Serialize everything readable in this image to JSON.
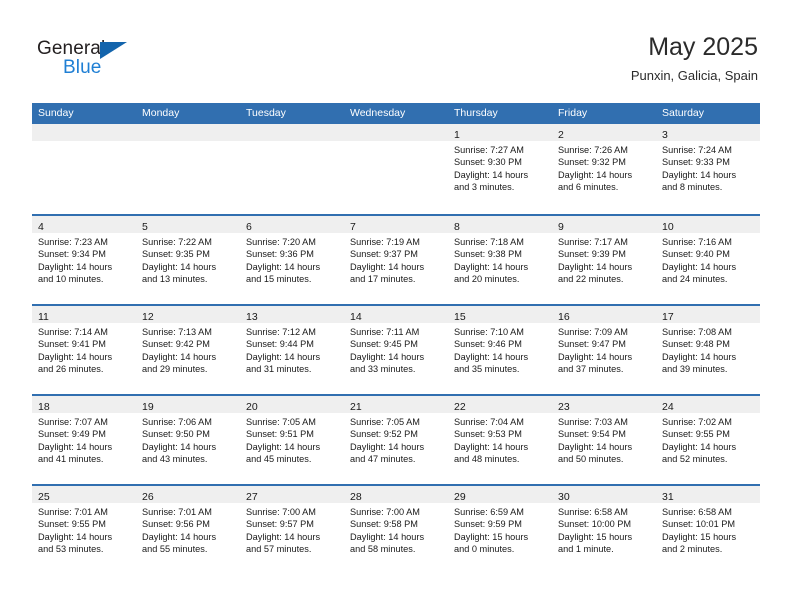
{
  "logo": {
    "word_top": "General",
    "word_bottom": "Blue",
    "triangle_color": "#1364ac",
    "blue_text_color": "#1f7fd4"
  },
  "header": {
    "title": "May 2025",
    "subtitle": "Punxin, Galicia, Spain"
  },
  "theme": {
    "header_blue": "#316fb0",
    "day_band_gray": "#efefef",
    "text_color": "#1a1a1a"
  },
  "weekday_headers": [
    "Sunday",
    "Monday",
    "Tuesday",
    "Wednesday",
    "Thursday",
    "Friday",
    "Saturday"
  ],
  "weeks": [
    [
      {
        "day": "",
        "sunrise": "",
        "sunset": "",
        "daylight_line1": "",
        "daylight_line2": "",
        "empty": true
      },
      {
        "day": "",
        "sunrise": "",
        "sunset": "",
        "daylight_line1": "",
        "daylight_line2": "",
        "empty": true
      },
      {
        "day": "",
        "sunrise": "",
        "sunset": "",
        "daylight_line1": "",
        "daylight_line2": "",
        "empty": true
      },
      {
        "day": "",
        "sunrise": "",
        "sunset": "",
        "daylight_line1": "",
        "daylight_line2": "",
        "empty": true
      },
      {
        "day": "1",
        "sunrise": "Sunrise: 7:27 AM",
        "sunset": "Sunset: 9:30 PM",
        "daylight_line1": "Daylight: 14 hours",
        "daylight_line2": "and 3 minutes."
      },
      {
        "day": "2",
        "sunrise": "Sunrise: 7:26 AM",
        "sunset": "Sunset: 9:32 PM",
        "daylight_line1": "Daylight: 14 hours",
        "daylight_line2": "and 6 minutes."
      },
      {
        "day": "3",
        "sunrise": "Sunrise: 7:24 AM",
        "sunset": "Sunset: 9:33 PM",
        "daylight_line1": "Daylight: 14 hours",
        "daylight_line2": "and 8 minutes."
      }
    ],
    [
      {
        "day": "4",
        "sunrise": "Sunrise: 7:23 AM",
        "sunset": "Sunset: 9:34 PM",
        "daylight_line1": "Daylight: 14 hours",
        "daylight_line2": "and 10 minutes."
      },
      {
        "day": "5",
        "sunrise": "Sunrise: 7:22 AM",
        "sunset": "Sunset: 9:35 PM",
        "daylight_line1": "Daylight: 14 hours",
        "daylight_line2": "and 13 minutes."
      },
      {
        "day": "6",
        "sunrise": "Sunrise: 7:20 AM",
        "sunset": "Sunset: 9:36 PM",
        "daylight_line1": "Daylight: 14 hours",
        "daylight_line2": "and 15 minutes."
      },
      {
        "day": "7",
        "sunrise": "Sunrise: 7:19 AM",
        "sunset": "Sunset: 9:37 PM",
        "daylight_line1": "Daylight: 14 hours",
        "daylight_line2": "and 17 minutes."
      },
      {
        "day": "8",
        "sunrise": "Sunrise: 7:18 AM",
        "sunset": "Sunset: 9:38 PM",
        "daylight_line1": "Daylight: 14 hours",
        "daylight_line2": "and 20 minutes."
      },
      {
        "day": "9",
        "sunrise": "Sunrise: 7:17 AM",
        "sunset": "Sunset: 9:39 PM",
        "daylight_line1": "Daylight: 14 hours",
        "daylight_line2": "and 22 minutes."
      },
      {
        "day": "10",
        "sunrise": "Sunrise: 7:16 AM",
        "sunset": "Sunset: 9:40 PM",
        "daylight_line1": "Daylight: 14 hours",
        "daylight_line2": "and 24 minutes."
      }
    ],
    [
      {
        "day": "11",
        "sunrise": "Sunrise: 7:14 AM",
        "sunset": "Sunset: 9:41 PM",
        "daylight_line1": "Daylight: 14 hours",
        "daylight_line2": "and 26 minutes."
      },
      {
        "day": "12",
        "sunrise": "Sunrise: 7:13 AM",
        "sunset": "Sunset: 9:42 PM",
        "daylight_line1": "Daylight: 14 hours",
        "daylight_line2": "and 29 minutes."
      },
      {
        "day": "13",
        "sunrise": "Sunrise: 7:12 AM",
        "sunset": "Sunset: 9:44 PM",
        "daylight_line1": "Daylight: 14 hours",
        "daylight_line2": "and 31 minutes."
      },
      {
        "day": "14",
        "sunrise": "Sunrise: 7:11 AM",
        "sunset": "Sunset: 9:45 PM",
        "daylight_line1": "Daylight: 14 hours",
        "daylight_line2": "and 33 minutes."
      },
      {
        "day": "15",
        "sunrise": "Sunrise: 7:10 AM",
        "sunset": "Sunset: 9:46 PM",
        "daylight_line1": "Daylight: 14 hours",
        "daylight_line2": "and 35 minutes."
      },
      {
        "day": "16",
        "sunrise": "Sunrise: 7:09 AM",
        "sunset": "Sunset: 9:47 PM",
        "daylight_line1": "Daylight: 14 hours",
        "daylight_line2": "and 37 minutes."
      },
      {
        "day": "17",
        "sunrise": "Sunrise: 7:08 AM",
        "sunset": "Sunset: 9:48 PM",
        "daylight_line1": "Daylight: 14 hours",
        "daylight_line2": "and 39 minutes."
      }
    ],
    [
      {
        "day": "18",
        "sunrise": "Sunrise: 7:07 AM",
        "sunset": "Sunset: 9:49 PM",
        "daylight_line1": "Daylight: 14 hours",
        "daylight_line2": "and 41 minutes."
      },
      {
        "day": "19",
        "sunrise": "Sunrise: 7:06 AM",
        "sunset": "Sunset: 9:50 PM",
        "daylight_line1": "Daylight: 14 hours",
        "daylight_line2": "and 43 minutes."
      },
      {
        "day": "20",
        "sunrise": "Sunrise: 7:05 AM",
        "sunset": "Sunset: 9:51 PM",
        "daylight_line1": "Daylight: 14 hours",
        "daylight_line2": "and 45 minutes."
      },
      {
        "day": "21",
        "sunrise": "Sunrise: 7:05 AM",
        "sunset": "Sunset: 9:52 PM",
        "daylight_line1": "Daylight: 14 hours",
        "daylight_line2": "and 47 minutes."
      },
      {
        "day": "22",
        "sunrise": "Sunrise: 7:04 AM",
        "sunset": "Sunset: 9:53 PM",
        "daylight_line1": "Daylight: 14 hours",
        "daylight_line2": "and 48 minutes."
      },
      {
        "day": "23",
        "sunrise": "Sunrise: 7:03 AM",
        "sunset": "Sunset: 9:54 PM",
        "daylight_line1": "Daylight: 14 hours",
        "daylight_line2": "and 50 minutes."
      },
      {
        "day": "24",
        "sunrise": "Sunrise: 7:02 AM",
        "sunset": "Sunset: 9:55 PM",
        "daylight_line1": "Daylight: 14 hours",
        "daylight_line2": "and 52 minutes."
      }
    ],
    [
      {
        "day": "25",
        "sunrise": "Sunrise: 7:01 AM",
        "sunset": "Sunset: 9:55 PM",
        "daylight_line1": "Daylight: 14 hours",
        "daylight_line2": "and 53 minutes."
      },
      {
        "day": "26",
        "sunrise": "Sunrise: 7:01 AM",
        "sunset": "Sunset: 9:56 PM",
        "daylight_line1": "Daylight: 14 hours",
        "daylight_line2": "and 55 minutes."
      },
      {
        "day": "27",
        "sunrise": "Sunrise: 7:00 AM",
        "sunset": "Sunset: 9:57 PM",
        "daylight_line1": "Daylight: 14 hours",
        "daylight_line2": "and 57 minutes."
      },
      {
        "day": "28",
        "sunrise": "Sunrise: 7:00 AM",
        "sunset": "Sunset: 9:58 PM",
        "daylight_line1": "Daylight: 14 hours",
        "daylight_line2": "and 58 minutes."
      },
      {
        "day": "29",
        "sunrise": "Sunrise: 6:59 AM",
        "sunset": "Sunset: 9:59 PM",
        "daylight_line1": "Daylight: 15 hours",
        "daylight_line2": "and 0 minutes."
      },
      {
        "day": "30",
        "sunrise": "Sunrise: 6:58 AM",
        "sunset": "Sunset: 10:00 PM",
        "daylight_line1": "Daylight: 15 hours",
        "daylight_line2": "and 1 minute."
      },
      {
        "day": "31",
        "sunrise": "Sunrise: 6:58 AM",
        "sunset": "Sunset: 10:01 PM",
        "daylight_line1": "Daylight: 15 hours",
        "daylight_line2": "and 2 minutes."
      }
    ]
  ]
}
